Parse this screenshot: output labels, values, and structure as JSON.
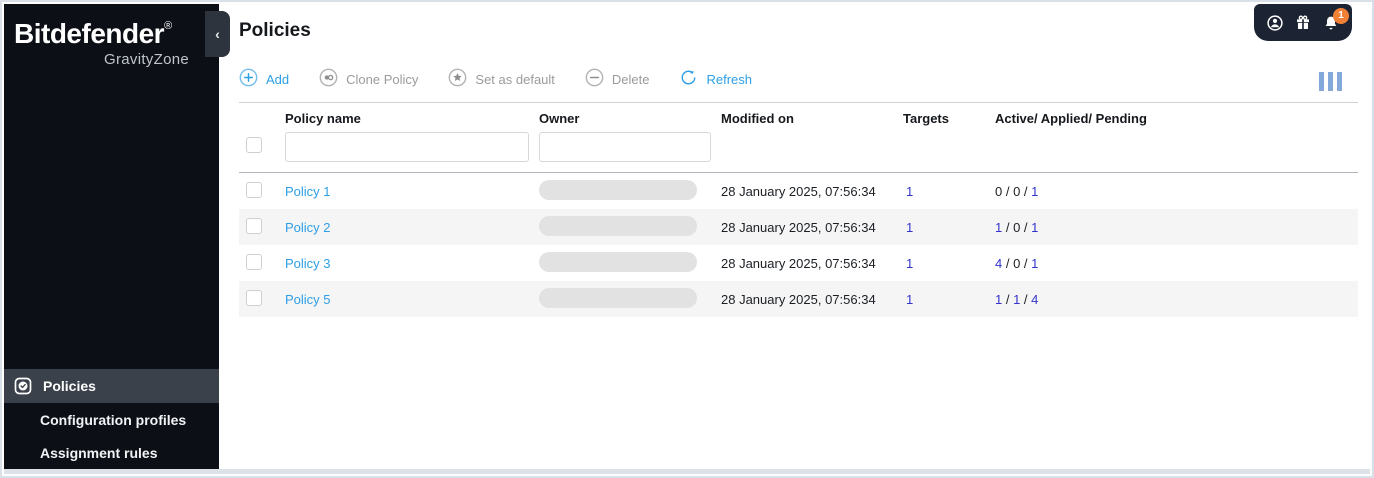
{
  "sidebar": {
    "brand": "Bitdefender",
    "brand_reg": "®",
    "product": "GravityZone",
    "collapse_icon": "‹",
    "items": [
      {
        "label": "Policies",
        "active": true
      },
      {
        "label": "Configuration profiles",
        "active": false
      },
      {
        "label": "Assignment rules",
        "active": false
      }
    ]
  },
  "header": {
    "title": "Policies",
    "topbar": {
      "badge_count": "1"
    }
  },
  "toolbar": {
    "items": [
      {
        "label": "Add",
        "state": "enabled"
      },
      {
        "label": "Clone Policy",
        "state": "disabled"
      },
      {
        "label": "Set as default",
        "state": "disabled"
      },
      {
        "label": "Delete",
        "state": "disabled"
      },
      {
        "label": "Refresh",
        "state": "enabled"
      }
    ]
  },
  "table": {
    "headers": [
      "Policy name",
      "Owner",
      "Modified on",
      "Targets",
      "Active/ Applied/ Pending"
    ],
    "filters": {
      "policy_name_value": "",
      "owner_value": ""
    },
    "rows": [
      {
        "name": "Policy 1",
        "modified": "28 January 2025, 07:56:34",
        "targets": "1",
        "active": "0",
        "applied": "0",
        "pending": "1"
      },
      {
        "name": "Policy 2",
        "modified": "28 January 2025, 07:56:34",
        "targets": "1",
        "active": "1",
        "applied": "0",
        "pending": "1"
      },
      {
        "name": "Policy 3",
        "modified": "28 January 2025, 07:56:34",
        "targets": "1",
        "active": "4",
        "applied": "0",
        "pending": "1"
      },
      {
        "name": "Policy 5",
        "modified": "28 January 2025, 07:56:34",
        "targets": "1",
        "active": "1",
        "applied": "1",
        "pending": "4"
      }
    ]
  },
  "colors": {
    "accent_blue": "#2d9fe6",
    "link_indigo": "#3434cd",
    "badge_orange": "#f08036",
    "sidebar_bg": "#0c1016",
    "active_item_bg": "#3a414b",
    "topbar_pill_bg": "#1c2433"
  }
}
